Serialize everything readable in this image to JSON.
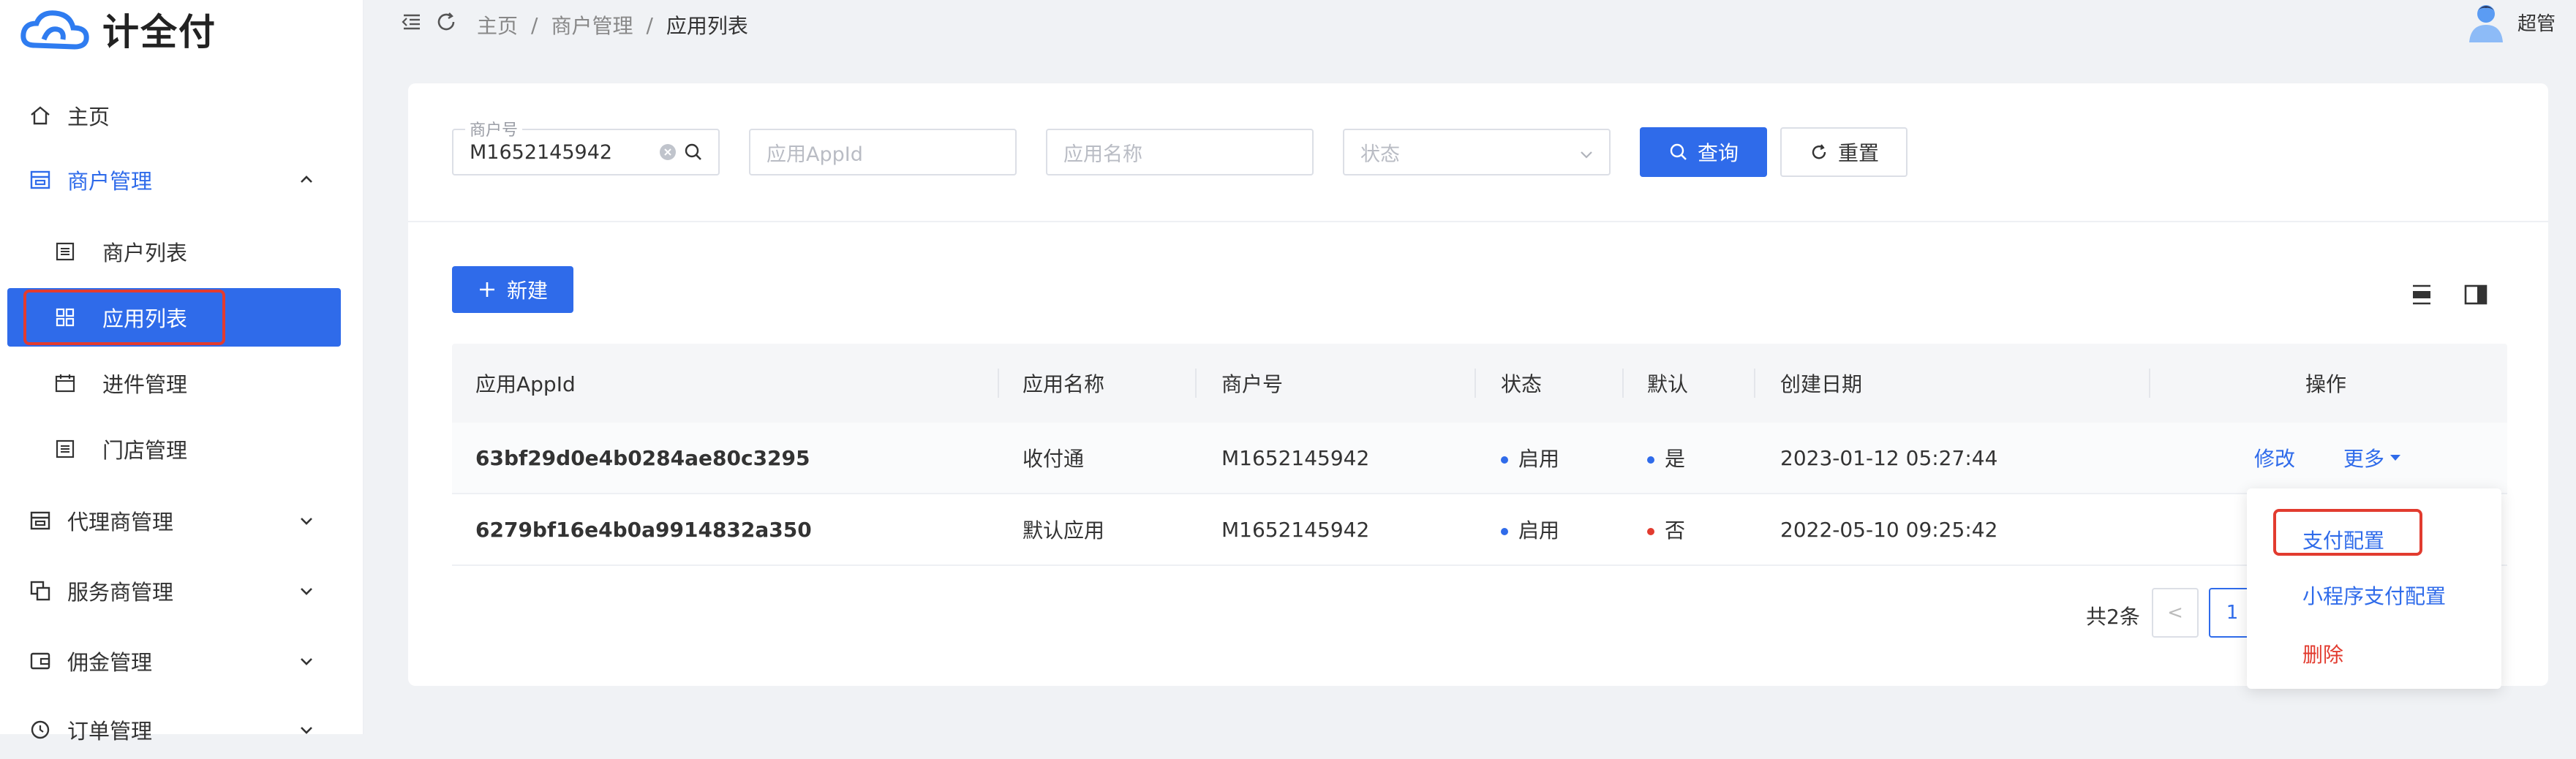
{
  "brand": {
    "name": "计全付"
  },
  "header": {
    "breadcrumb": [
      "主页",
      "商户管理",
      "应用列表"
    ],
    "separator": "/",
    "user_name": "超管"
  },
  "sidebar": {
    "items": [
      {
        "label": "主页",
        "icon": "home-icon"
      },
      {
        "label": "商户管理",
        "icon": "shop-icon",
        "expanded": true
      },
      {
        "label": "商户列表",
        "icon": "list-icon"
      },
      {
        "label": "应用列表",
        "icon": "grid-icon",
        "active": true
      },
      {
        "label": "进件管理",
        "icon": "calendar-icon"
      },
      {
        "label": "门店管理",
        "icon": "list-icon"
      },
      {
        "label": "代理商管理",
        "icon": "shop-icon"
      },
      {
        "label": "服务商管理",
        "icon": "copy-icon"
      },
      {
        "label": "佣金管理",
        "icon": "wallet-icon"
      },
      {
        "label": "订单管理",
        "icon": "clock-icon"
      }
    ]
  },
  "filters": {
    "merchant_label": "商户号",
    "merchant_value": "M1652145942",
    "appid_placeholder": "应用AppId",
    "appname_placeholder": "应用名称",
    "status_placeholder": "状态",
    "search_label": "查询",
    "reset_label": "重置"
  },
  "toolbar": {
    "new_label": "新建"
  },
  "table": {
    "columns": [
      "应用AppId",
      "应用名称",
      "商户号",
      "状态",
      "默认",
      "创建日期",
      "操作"
    ],
    "rows": [
      {
        "appid": "63bf29d0e4b0284ae80c3295",
        "name": "收付通",
        "merchant": "M1652145942",
        "status": "启用",
        "default": "是",
        "created": "2023-01-12 05:27:44",
        "edit": "修改",
        "more": "更多"
      },
      {
        "appid": "6279bf16e4b0a9914832a350",
        "name": "默认应用",
        "merchant": "M1652145942",
        "status": "启用",
        "default": "否",
        "created": "2022-05-10 09:25:42"
      }
    ]
  },
  "dropdown": {
    "items": [
      "支付配置",
      "小程序支付配置",
      "删除"
    ]
  },
  "pagination": {
    "total_text": "共2条",
    "prev": "<",
    "current_page": "1"
  },
  "colors": {
    "primary": "#2f6bea",
    "danger": "#e23b2f",
    "status_on": "#2f6bea",
    "default_no": "#e23b2f"
  }
}
